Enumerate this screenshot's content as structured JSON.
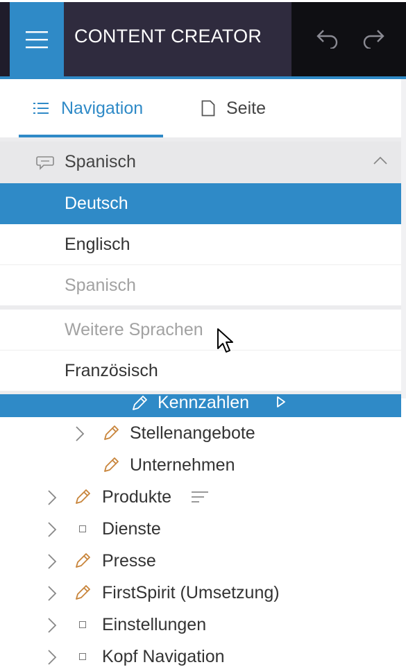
{
  "header": {
    "title": "CONTENT CREATOR",
    "menu_icon": "hamburger-icon",
    "undo_icon": "undo-icon",
    "redo_icon": "redo-icon"
  },
  "tabs": [
    {
      "label": "Navigation",
      "icon": "list-icon",
      "active": true
    },
    {
      "label": "Seite",
      "icon": "page-icon",
      "active": false
    }
  ],
  "language_select": {
    "current": "Spanisch",
    "icon": "speech-bubble-icon",
    "options": [
      {
        "label": "Deutsch",
        "selected": true
      },
      {
        "label": "Englisch"
      },
      {
        "label": "Spanisch",
        "disabled": true
      }
    ],
    "more_header": "Weitere Sprachen",
    "more_options": [
      {
        "label": "Französisch"
      }
    ]
  },
  "tree": {
    "selected": {
      "label": "Kennzahlen"
    },
    "items": [
      {
        "label": "Stellenangebote",
        "icon": "pencil-icon",
        "expandable": true
      },
      {
        "label": "Unternehmen",
        "icon": "pencil-icon",
        "expandable": false
      },
      {
        "label": "Produkte",
        "icon": "pencil-icon",
        "expandable": true,
        "extra_icon": "text-lines-icon"
      },
      {
        "label": "Dienste",
        "icon": "square-icon",
        "expandable": true
      },
      {
        "label": "Presse",
        "icon": "pencil-icon",
        "expandable": true
      },
      {
        "label": "FirstSpirit (Umsetzung)",
        "icon": "pencil-icon",
        "expandable": true
      },
      {
        "label": "Einstellungen",
        "icon": "square-icon",
        "expandable": true
      },
      {
        "label": "Kopf Navigation",
        "icon": "square-icon",
        "expandable": true
      }
    ]
  },
  "colors": {
    "accent": "#2f8ac7",
    "header_bg": "#2f2b3e",
    "pencil": "#c8843a",
    "disabled_text": "#a2a2a2"
  }
}
